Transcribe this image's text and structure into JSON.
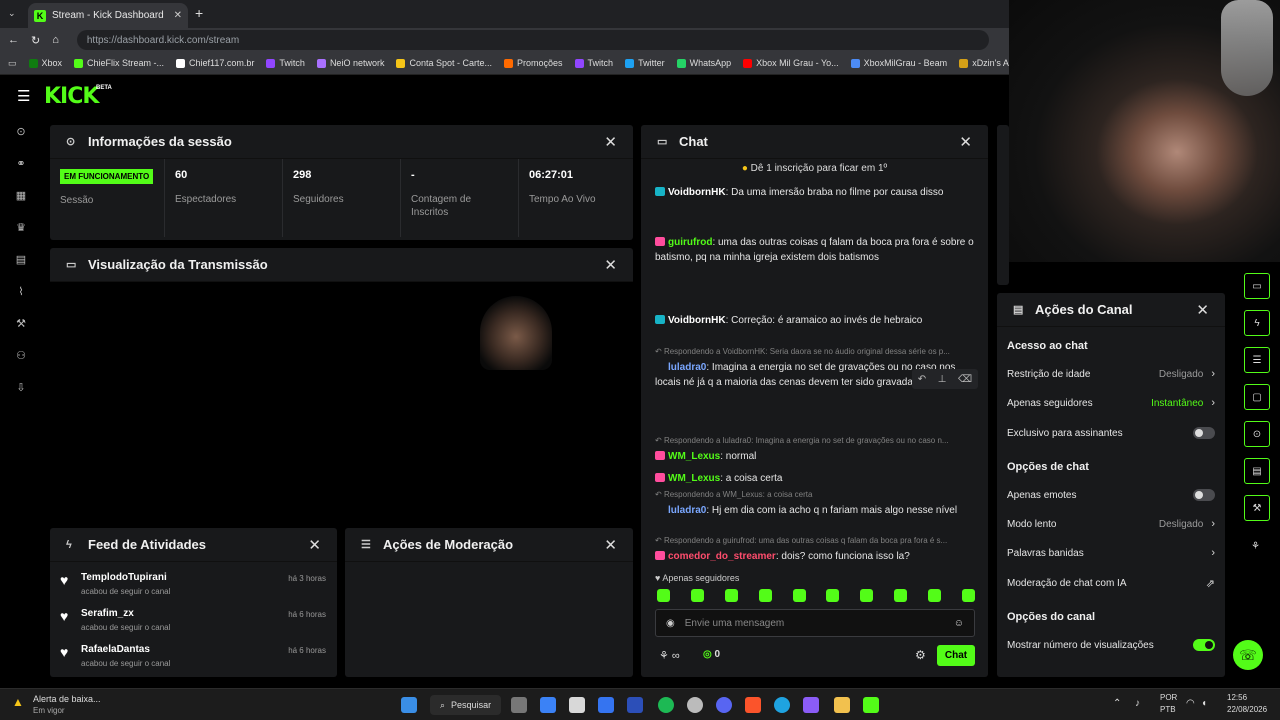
{
  "browser": {
    "tab_title": "Stream - Kick Dashboard",
    "new_tab": "+",
    "url": "https://dashboard.kick.com/stream",
    "bookmarks": [
      {
        "label": "Xbox",
        "color": "#107c10"
      },
      {
        "label": "ChieFlix Stream -...",
        "color": "#53fc18"
      },
      {
        "label": "Chief117.com.br",
        "color": "#ffffff"
      },
      {
        "label": "Twitch",
        "color": "#9146ff"
      },
      {
        "label": "NeiO network",
        "color": "#a970ff"
      },
      {
        "label": "Conta Spot - Carte...",
        "color": "#f5c518"
      },
      {
        "label": "Promoções",
        "color": "#ff6a00"
      },
      {
        "label": "Twitch",
        "color": "#9146ff"
      },
      {
        "label": "Twitter",
        "color": "#1da1f2"
      },
      {
        "label": "WhatsApp",
        "color": "#25d366"
      },
      {
        "label": "Xbox Mil Grau - Yo...",
        "color": "#ff0000"
      },
      {
        "label": "XboxMilGrau - Beam",
        "color": "#4c8bf5"
      },
      {
        "label": "xDzin's Achiever",
        "color": "#d4a017"
      }
    ]
  },
  "kick": {
    "logo": "KICK",
    "beta": "BETA",
    "accent": "#53fc18"
  },
  "session": {
    "title": "Informações da sessão",
    "status_badge": "EM FUNCIONAMENTO",
    "status_label": "Sessão",
    "stats": [
      {
        "value": "60",
        "label": "Espectadores"
      },
      {
        "value": "298",
        "label": "Seguidores"
      },
      {
        "value": "-",
        "label": "Contagem de Inscritos"
      },
      {
        "value": "06:27:01",
        "label": "Tempo Ao Vivo"
      }
    ]
  },
  "preview": {
    "title": "Visualização da Transmissão"
  },
  "feed": {
    "title": "Feed de Atividades",
    "items": [
      {
        "user": "TemplodoTupirani",
        "action": "acabou de seguir o canal",
        "time": "há 3 horas"
      },
      {
        "user": "Serafim_zx",
        "action": "acabou de seguir o canal",
        "time": "há 6 horas"
      },
      {
        "user": "RafaelaDantas",
        "action": "acabou de seguir o canal",
        "time": "há 6 horas"
      }
    ]
  },
  "moderation": {
    "title": "Ações de Moderação"
  },
  "chat": {
    "title": "Chat",
    "sub_banner": "Dê 1 inscrição para ficar em 1º",
    "messages": [
      {
        "reply": "",
        "user": "VoidbornHK",
        "color": "#ffffff",
        "text": "Da uma imersão braba no filme por causa disso"
      },
      {
        "reply": "",
        "user": "guirufrod",
        "color": "#53fc18",
        "text": "uma das outras coisas q falam da boca pra fora é sobre o batismo, pq na minha igreja existem dois batismos"
      },
      {
        "reply": "",
        "user": "VoidbornHK",
        "color": "#ffffff",
        "text": "Correção: é aramaico ao invés de hebraico"
      },
      {
        "reply": "Respondendo a VoidbornHK: Seria daora se no áudio original dessa série os p...",
        "user": "luladra0",
        "color": "#7aa7ff",
        "text": "Imagina a energia no set de gravações ou no caso nos locais né já q a maioria das cenas devem ter sido gravadas a céu"
      },
      {
        "reply": "Respondendo a luladra0: Imagina a energia no set de gravações ou no caso n...",
        "user": "WM_Lexus",
        "color": "#53fc18",
        "text": "normal"
      },
      {
        "reply": "",
        "user": "WM_Lexus",
        "color": "#53fc18",
        "text": "a coisa certa"
      },
      {
        "reply": "Respondendo a WM_Lexus: a coisa certa",
        "user": "luladra0",
        "color": "#7aa7ff",
        "text": "Hj em dia com ia acho q n fariam mais algo nesse nível"
      },
      {
        "reply": "Respondendo a guirufrod: uma das outras coisas q falam da boca pra fora é s...",
        "user": "comedor_do_streamer",
        "color": "#ff4d6d",
        "text": "dois? como funciona isso la?"
      }
    ],
    "followers_only": "Apenas seguidores",
    "input_placeholder": "Envie uma mensagem",
    "points": "0",
    "send_button": "Chat"
  },
  "channel_actions": {
    "title": "Ações do Canal",
    "chat_access": "Acesso ao chat",
    "age_restriction": {
      "label": "Restrição de idade",
      "value": "Desligado"
    },
    "followers_only": {
      "label": "Apenas seguidores",
      "value": "Instantâneo"
    },
    "subscribers_only": {
      "label": "Exclusivo para assinantes"
    },
    "chat_options": "Opções de chat",
    "emotes_only": {
      "label": "Apenas emotes"
    },
    "slow_mode": {
      "label": "Modo lento",
      "value": "Desligado"
    },
    "banned_words": {
      "label": "Palavras banidas"
    },
    "ai_moderation": {
      "label": "Moderação de chat com IA"
    },
    "channel_options": "Opções do canal",
    "show_views": {
      "label": "Mostrar número de visualizações"
    }
  },
  "taskbar": {
    "alert_title": "Alerta de baixa...",
    "alert_sub": "Em vigor",
    "search": "Pesquisar",
    "lang": "POR",
    "layout": "PTB",
    "time": "12:56",
    "date": "22/08/2026"
  }
}
